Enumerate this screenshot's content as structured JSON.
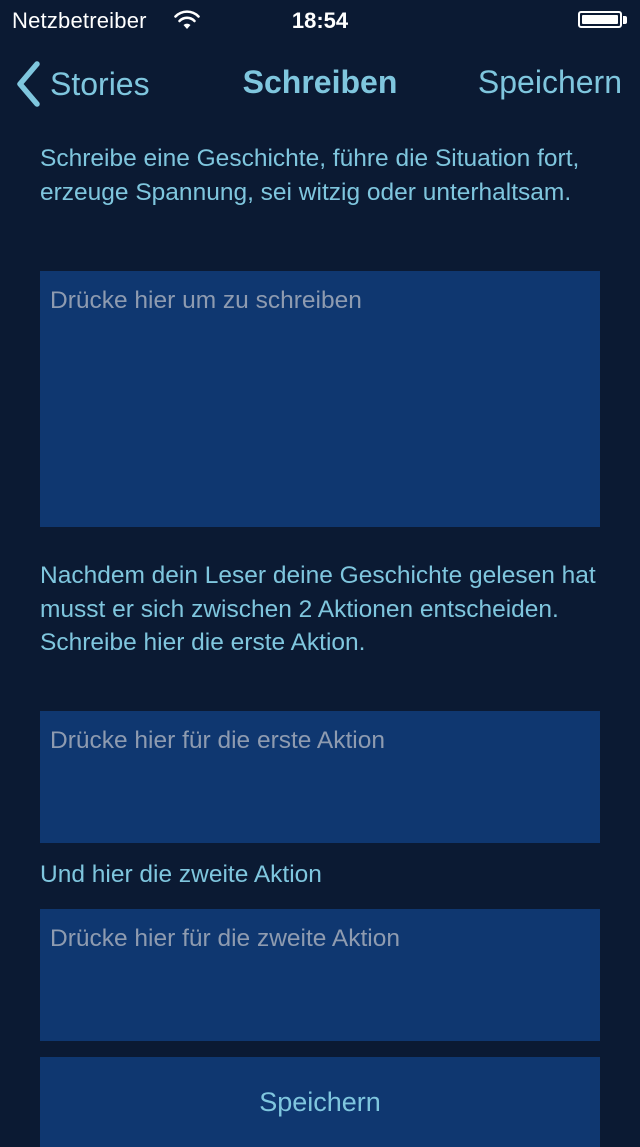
{
  "status_bar": {
    "carrier": "Netzbetreiber",
    "time": "18:54",
    "battery_level": 1.0
  },
  "nav": {
    "back_label": "Stories",
    "title": "Schreiben",
    "save_label": "Speichern"
  },
  "story": {
    "instruction": "Schreibe eine Geschichte, führe die Situation fort, erzeuge Spannung, sei witzig oder unterhaltsam.",
    "placeholder": "Drücke hier um zu schreiben",
    "value": ""
  },
  "action_one": {
    "instruction": "Nachdem dein Leser deine Geschichte gelesen hat musst er sich zwischen 2 Aktionen entscheiden. Schreibe hier die erste Aktion.",
    "placeholder": "Drücke hier für die erste Aktion",
    "value": ""
  },
  "action_two": {
    "instruction": "Und hier die zweite Aktion",
    "placeholder": "Drücke hier für die zweite Aktion",
    "value": ""
  },
  "save_button": {
    "label": "Speichern"
  },
  "colors": {
    "background": "#0b1a33",
    "accent": "#7fc6de",
    "field": "#0f3770",
    "placeholder": "#8e9bb0"
  }
}
